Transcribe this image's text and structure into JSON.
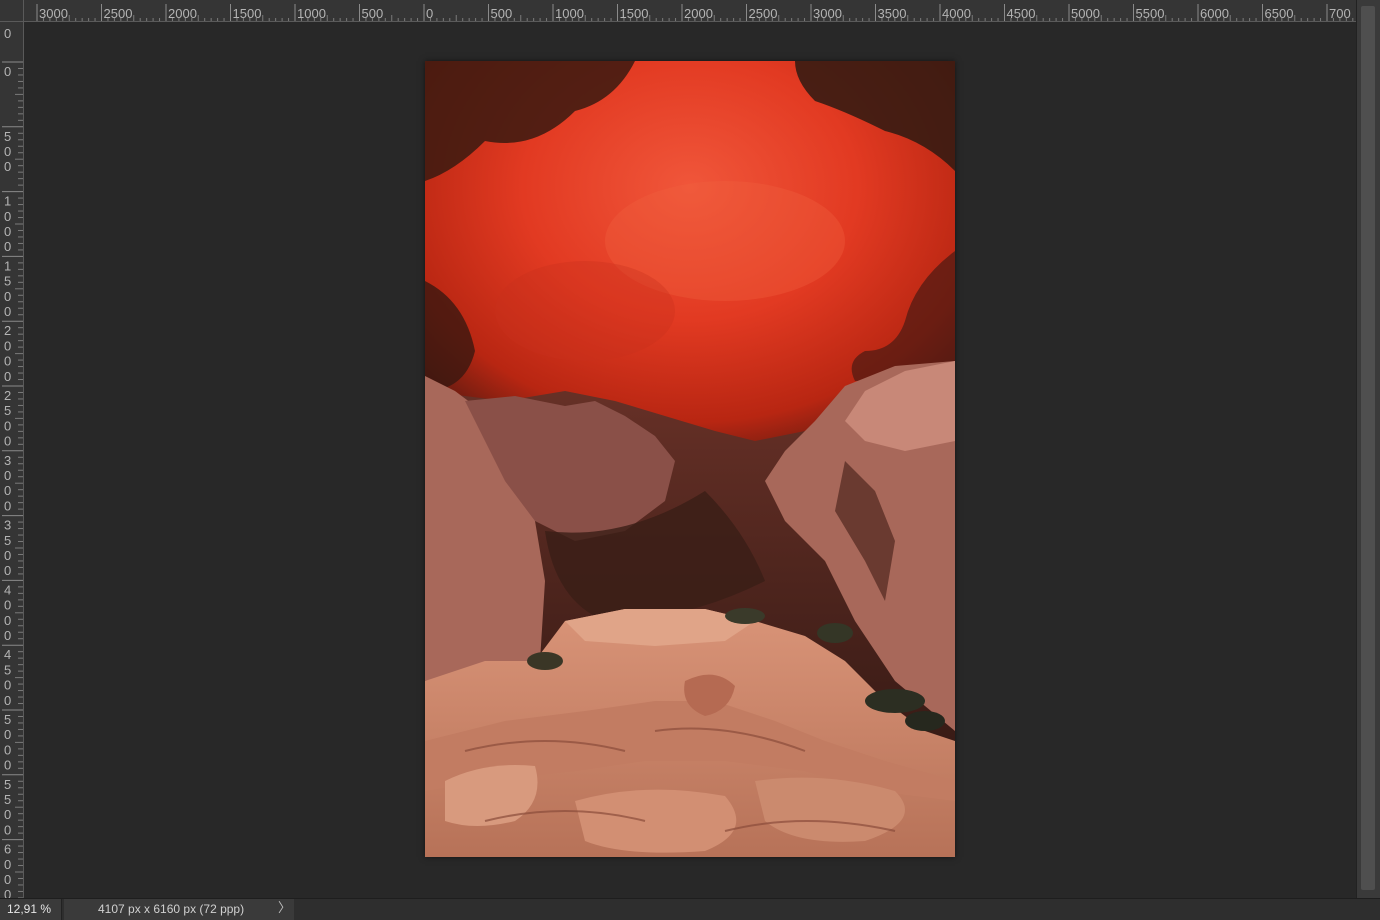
{
  "rulers": {
    "top_labels": [
      "3000",
      "2500",
      "2000",
      "1500",
      "1000",
      "500",
      "0",
      "500",
      "1000",
      "1500",
      "2000",
      "2500",
      "3000",
      "3500",
      "4000",
      "4500",
      "5000",
      "5500",
      "6000",
      "6500",
      "700"
    ],
    "left_labels": [
      "0",
      "500",
      "1000",
      "1500",
      "2000",
      "2500",
      "3000",
      "3500",
      "4000",
      "4500",
      "5000",
      "5500",
      "6000"
    ]
  },
  "statusbar": {
    "zoom": "12,91 %",
    "doc_info": "4107 px x 6160 px (72 ppp)",
    "arrow": "〉"
  },
  "colors": {
    "app_bg": "#282828",
    "ruler_bg": "#353535",
    "ruler_text": "#b4b4b4",
    "sky_red": "#e8402a",
    "rock": "#c98a70"
  }
}
